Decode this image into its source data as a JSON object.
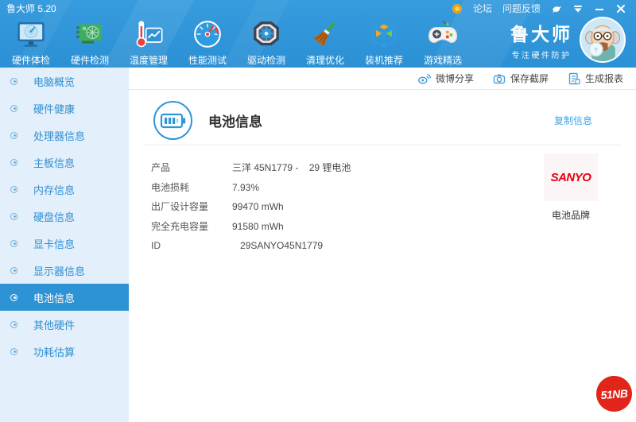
{
  "window": {
    "title": "鲁大师 5.20"
  },
  "titlebar": {
    "forum": "论坛",
    "feedback": "问题反馈",
    "icons": [
      "medal-icon",
      "dove-icon",
      "skin-icon",
      "minimize-icon",
      "close-icon"
    ]
  },
  "toolbar": {
    "items": [
      {
        "label": "硬件体检",
        "icon": "monitor-radar-icon"
      },
      {
        "label": "硬件检测",
        "icon": "gpu-card-icon"
      },
      {
        "label": "温度管理",
        "icon": "thermometer-chart-icon"
      },
      {
        "label": "性能测试",
        "icon": "speedometer-icon"
      },
      {
        "label": "驱动检测",
        "icon": "gear-nut-icon"
      },
      {
        "label": "清理优化",
        "icon": "broom-icon"
      },
      {
        "label": "装机推荐",
        "icon": "cube-icon"
      },
      {
        "label": "游戏精选",
        "icon": "gamepad-icon"
      }
    ],
    "brand": {
      "name": "鲁大师",
      "slogan": "专注硬件防护",
      "avatar": "mascot-avatar"
    }
  },
  "actionbar": {
    "items": [
      {
        "label": "微博分享",
        "icon": "weibo-icon"
      },
      {
        "label": "保存截屏",
        "icon": "camera-icon"
      },
      {
        "label": "生成报表",
        "icon": "report-icon"
      }
    ]
  },
  "sidebar": {
    "items": [
      {
        "label": "电脑概览",
        "selected": false
      },
      {
        "label": "硬件健康",
        "selected": false
      },
      {
        "label": "处理器信息",
        "selected": false
      },
      {
        "label": "主板信息",
        "selected": false
      },
      {
        "label": "内存信息",
        "selected": false
      },
      {
        "label": "硬盘信息",
        "selected": false
      },
      {
        "label": "显卡信息",
        "selected": false
      },
      {
        "label": "显示器信息",
        "selected": false
      },
      {
        "label": "电池信息",
        "selected": true
      },
      {
        "label": "其他硬件",
        "selected": false
      },
      {
        "label": "功耗估算",
        "selected": false
      }
    ]
  },
  "main": {
    "section_title": "电池信息",
    "section_icon": "battery-icon",
    "copy_link": "复制信息",
    "rows": [
      {
        "label": "产品",
        "value": "三洋 45N1779 -    29 锂电池"
      },
      {
        "label": "电池损耗",
        "value": "7.93%"
      },
      {
        "label": "出厂设计容量",
        "value": "99470 mWh"
      },
      {
        "label": "完全充电容量",
        "value": "91580 mWh"
      },
      {
        "label": "ID",
        "value": "   29SANYO45N1779"
      }
    ],
    "brand_panel": {
      "logo": "SANYO",
      "caption": "电池品牌"
    },
    "watermark": "51NB"
  },
  "colors": {
    "header_blue": "#2e93d7",
    "sidebar_bg": "#e3effa",
    "selected_blue": "#2e93d5",
    "link_blue": "#39a5ec",
    "sanyo_red": "#e60012",
    "badge_red": "#e1251b"
  }
}
